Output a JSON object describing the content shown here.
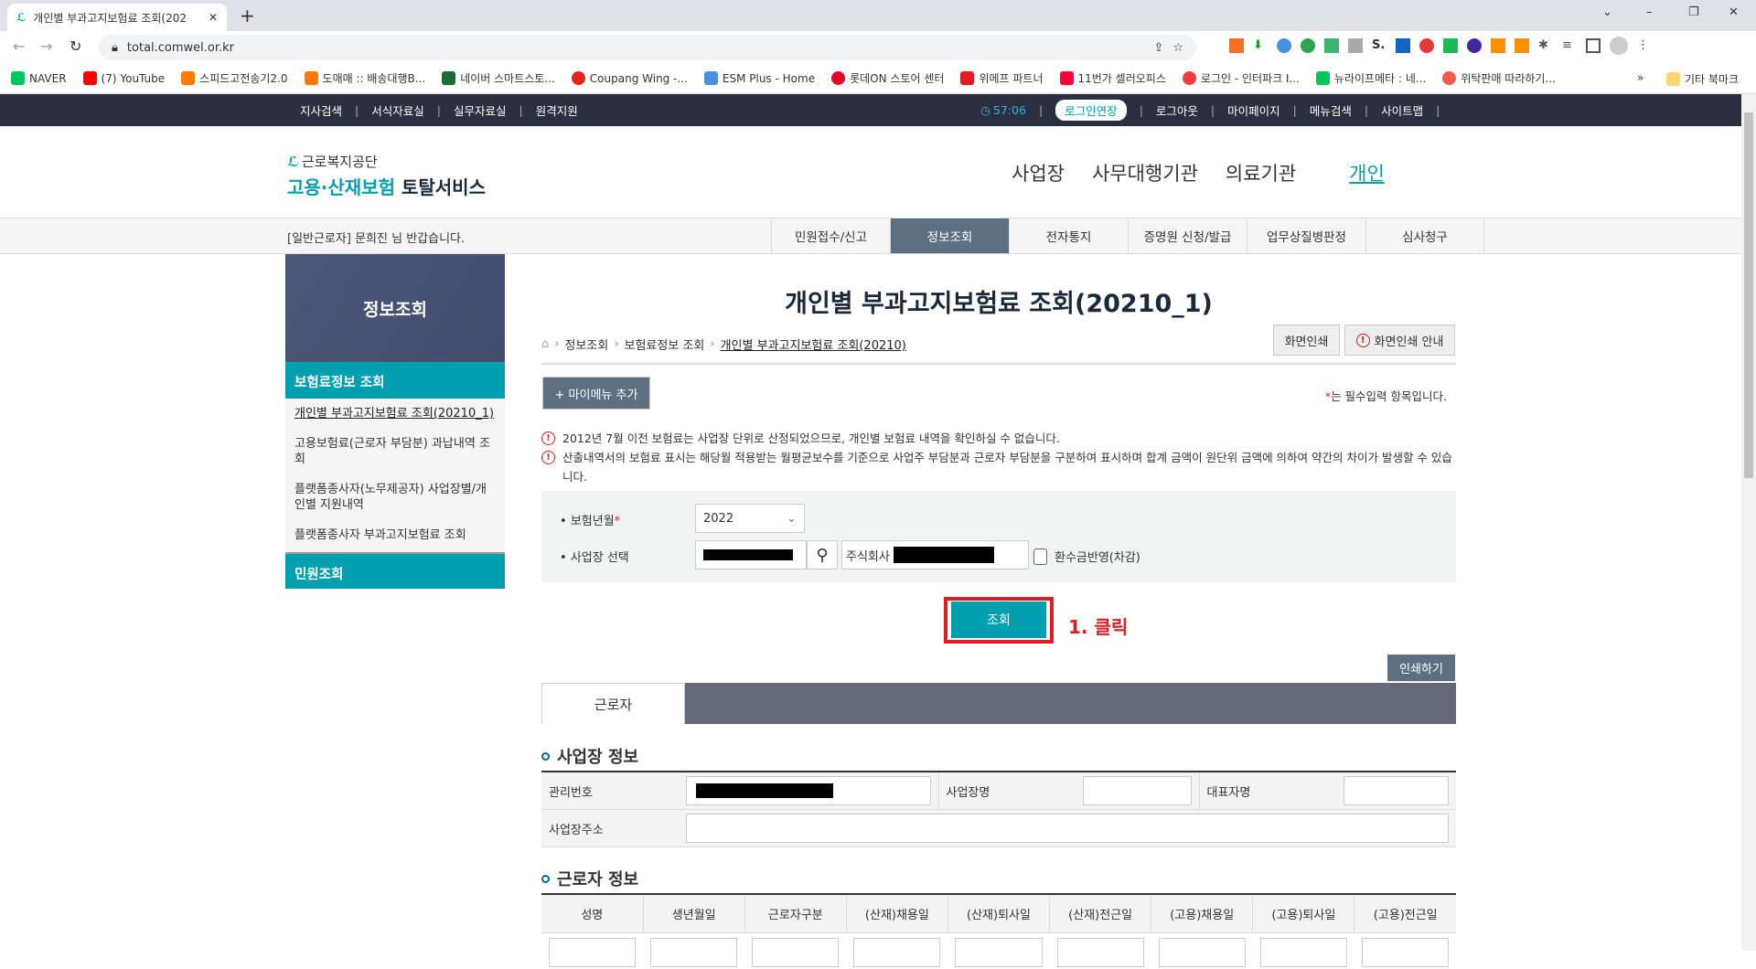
{
  "browser": {
    "tab_title": "개인별 부과고지보험료 조회(202",
    "url": "total.comwel.or.kr",
    "bookmarks": [
      {
        "label": "NAVER",
        "color": "#03c75a"
      },
      {
        "label": "(7) YouTube",
        "color": "#ff0000"
      },
      {
        "label": "스피드고전송기2.0",
        "color": "#ff7a00"
      },
      {
        "label": "도매매 :: 배송대행B...",
        "color": "#ff7a00"
      },
      {
        "label": "네이버 스마트스토...",
        "color": "#1e6b3a"
      },
      {
        "label": "Coupang Wing -...",
        "color": "#e1251b"
      },
      {
        "label": "ESM Plus - Home",
        "color": "#4a90e2"
      },
      {
        "label": "롯데ON 스토어 센터",
        "color": "#e4002b"
      },
      {
        "label": "위메프 파트너",
        "color": "#e31b23"
      },
      {
        "label": "11번가 셀러오피스",
        "color": "#ff0038"
      },
      {
        "label": "로그인 - 인터파크 I...",
        "color": "#ef3e42"
      },
      {
        "label": "뉴라이프메타 : 네...",
        "color": "#03c75a"
      },
      {
        "label": "위탁판매 따라하기...",
        "color": "#f05a4f"
      }
    ],
    "bookmarks_more": "»",
    "other_bookmarks": "기타 북마크"
  },
  "topbar": {
    "left": [
      "지사검색",
      "서식자료실",
      "실무자료실",
      "원격지원"
    ],
    "timer": "57:06",
    "extend": "로그인연장",
    "right": [
      "로그아웃",
      "마이페이지",
      "메뉴검색",
      "사이트맵"
    ]
  },
  "header": {
    "logo_top": "근로복지공단",
    "logo_main_a": "고용·산재보험",
    "logo_main_b": "토탈서비스",
    "nav": [
      "사업장",
      "사무대행기관",
      "의료기관",
      "개인"
    ]
  },
  "gnb": {
    "greeting_prefix": "[일반근로자] 문희진",
    "greeting_suffix": " 님 반갑습니다.",
    "items": [
      "민원접수/신고",
      "정보조회",
      "전자통지",
      "증명원 신청/발급",
      "업무상질병판정",
      "심사청구"
    ],
    "active": 1
  },
  "sidebar": {
    "title": "정보조회",
    "section1": "보험료정보 조회",
    "items": [
      "개인별 부과고지보험료 조회(20210_1)",
      "고용보험료(근로자 부담분) 과납내역 조회",
      "플랫폼종사자(노무제공자) 사업장별/개인별 지원내역",
      "플랫폼종사자 부과고지보험료 조회"
    ],
    "section2": "민원조회"
  },
  "page": {
    "title": "개인별 부과고지보험료 조회(20210_1)",
    "breadcrumb": [
      "정보조회",
      "보험료정보 조회",
      "개인별 부과고지보험료 조회(20210)"
    ],
    "print_btn": "화면인쇄",
    "print_guide_btn": "화면인쇄 안내",
    "mymenu_btn": "+ 마이메뉴 추가",
    "required_note": "는 필수입력 항목입니다.",
    "notices": [
      "2012년 7월 이전 보험료는 사업장 단위로 산정되었으므로, 개인별 보험료 내역을 확인하실 수 없습니다.",
      "산출내역서의 보험료 표시는 해당월 적용받는 월평균보수를 기준으로 사업주 부담분과 근로자 부담분을 구분하여 표시하며 합계 금액이 원단위 금액에 의하여 약간의 차이가 발생할 수 있습니다."
    ]
  },
  "form": {
    "year_label": "보험년월",
    "year_value": "2022",
    "biz_label": "사업장 선택",
    "company_prefix": "주식회사",
    "refund_label": "환수금반영(차감)",
    "refund_checked": false,
    "search_btn": "조회",
    "annotation": "1. 클릭"
  },
  "results": {
    "print_btn": "인쇄하기",
    "tab": "근로자",
    "biz_heading": "사업장 정보",
    "biz_fields": [
      "관리번호",
      "사업장명",
      "대표자명",
      "사업장주소"
    ],
    "worker_heading": "근로자 정보",
    "worker_columns": [
      "성명",
      "생년월일",
      "근로자구분",
      "(산재)채용일",
      "(산재)퇴사일",
      "(산재)전근일",
      "(고용)채용일",
      "(고용)퇴사일",
      "(고용)전근일"
    ]
  },
  "colors": {
    "teal": "#00a0b0",
    "navy": "#2b3040",
    "annotation_red": "#e31b23"
  }
}
